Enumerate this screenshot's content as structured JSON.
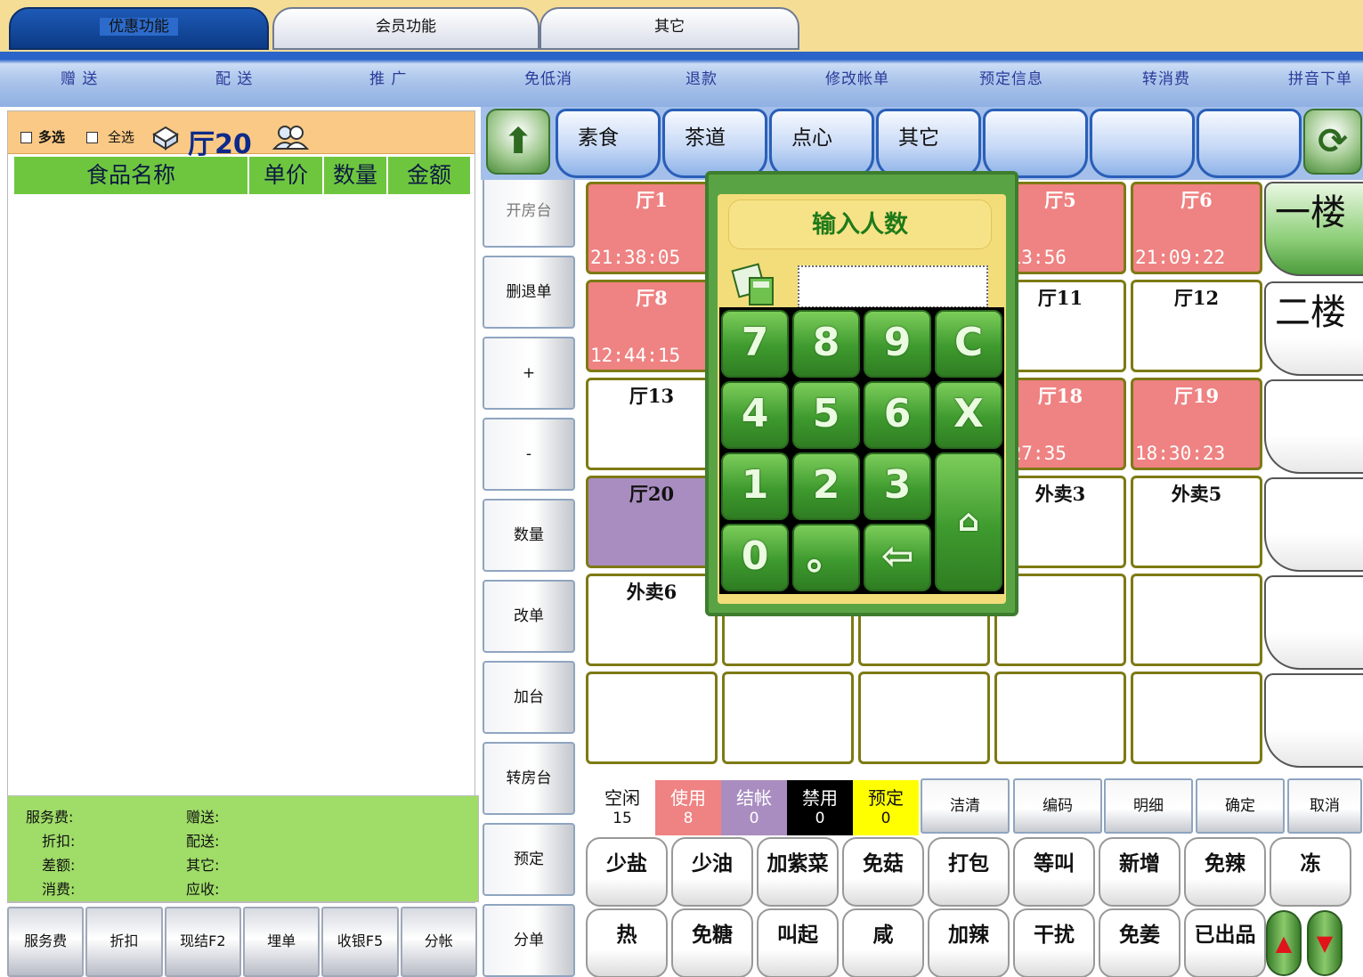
{
  "top_tabs": [
    {
      "label": "优惠功能",
      "active": true
    },
    {
      "label": "会员功能",
      "active": false
    },
    {
      "label": "其它",
      "active": false
    }
  ],
  "menu": [
    "赠 送",
    "配 送",
    "推 广",
    "免低消",
    "退款",
    "修改帐单",
    "预定信息",
    "转消费",
    "拼音下单"
  ],
  "left": {
    "multi_select": "多选",
    "select_all": "全选",
    "hall": "厅20",
    "columns": [
      "食品名称",
      "单价",
      "数量",
      "金额"
    ]
  },
  "summary": {
    "service_fee": "服务费:",
    "gift": "赠送:",
    "discount": "折扣:",
    "delivery": "配送:",
    "difference": "差额:",
    "other": "其它:",
    "consume": "消费:",
    "receivable": "应收:"
  },
  "bottom_buttons": [
    "服务费",
    "折扣",
    "现结F2",
    "埋单",
    "收银F5",
    "分帐"
  ],
  "mid_buttons": [
    "开房台",
    "删退单",
    "+",
    "-",
    "数量",
    "改单",
    "加台",
    "转房台",
    "预定",
    "分单"
  ],
  "categories": [
    "素食",
    "茶道",
    "点心",
    "其它",
    "",
    "",
    ""
  ],
  "rooms": [
    {
      "name": "厅1",
      "time": "21:38:05",
      "status": "used"
    },
    {
      "name": "",
      "time": "",
      "status": "empty"
    },
    {
      "name": "",
      "time": "",
      "status": "empty"
    },
    {
      "name": "厅5",
      "time": ":13:56",
      "status": "used"
    },
    {
      "name": "厅6",
      "time": "21:09:22",
      "status": "used"
    },
    {
      "name": "厅8",
      "time": "12:44:15",
      "status": "used"
    },
    {
      "name": "",
      "time": "",
      "status": "empty"
    },
    {
      "name": "",
      "time": "",
      "status": "empty"
    },
    {
      "name": "厅11",
      "time": "",
      "status": "empty"
    },
    {
      "name": "厅12",
      "time": "",
      "status": "empty"
    },
    {
      "name": "厅13",
      "time": "",
      "status": "empty"
    },
    {
      "name": "",
      "time": "",
      "status": "empty"
    },
    {
      "name": "",
      "time": "",
      "status": "empty"
    },
    {
      "name": "厅18",
      "time": ":27:35",
      "status": "used"
    },
    {
      "name": "厅19",
      "time": "18:30:23",
      "status": "used"
    },
    {
      "name": "厅20",
      "time": "",
      "status": "closed"
    },
    {
      "name": "",
      "time": "",
      "status": "empty"
    },
    {
      "name": "",
      "time": "",
      "status": "empty"
    },
    {
      "name": "外卖3",
      "time": "",
      "status": "empty"
    },
    {
      "name": "外卖5",
      "time": "",
      "status": "empty"
    },
    {
      "name": "外卖6",
      "time": "",
      "status": "empty"
    },
    {
      "name": "",
      "time": "",
      "status": "empty"
    },
    {
      "name": "",
      "time": "",
      "status": "empty"
    },
    {
      "name": "",
      "time": "",
      "status": "empty"
    },
    {
      "name": "",
      "time": "",
      "status": "empty"
    },
    {
      "name": "",
      "time": "",
      "status": "empty"
    },
    {
      "name": "",
      "time": "",
      "status": "empty"
    },
    {
      "name": "",
      "time": "",
      "status": "empty"
    },
    {
      "name": "",
      "time": "",
      "status": "empty"
    },
    {
      "name": "",
      "time": "",
      "status": "empty"
    }
  ],
  "floors": [
    "一楼",
    "二楼",
    "",
    "",
    "",
    ""
  ],
  "status_legend": [
    {
      "label": "空闲",
      "count": "15",
      "bg": "#ffffff",
      "fg": "#111111"
    },
    {
      "label": "使用",
      "count": "8",
      "bg": "#ef8282",
      "fg": "#ffffff"
    },
    {
      "label": "结帐",
      "count": "0",
      "bg": "#a98dc0",
      "fg": "#ffffff"
    },
    {
      "label": "禁用",
      "count": "0",
      "bg": "#000000",
      "fg": "#ffffff"
    },
    {
      "label": "预定",
      "count": "0",
      "bg": "#ffff00",
      "fg": "#111111"
    }
  ],
  "actions": [
    "洁清",
    "编码",
    "明细",
    "确定",
    "取消"
  ],
  "tastes_row1": [
    "少盐",
    "少油",
    "加紫菜",
    "免菇",
    "打包",
    "等叫",
    "新增",
    "免辣",
    "冻"
  ],
  "tastes_row2": [
    "热",
    "免糖",
    "叫起",
    "咸",
    "加辣",
    "干扰",
    "免姜",
    "已出品"
  ],
  "keypad": {
    "title": "输入人数",
    "value": "",
    "keys": [
      "7",
      "8",
      "9",
      "C",
      "4",
      "5",
      "6",
      "X",
      "1",
      "2",
      "3",
      "0",
      "。",
      "⇦"
    ]
  },
  "colors": {
    "accent_green": "#6ec63f",
    "used": "#ef8282",
    "closed": "#a98dc0",
    "tab_bar": "#f5dd96"
  }
}
